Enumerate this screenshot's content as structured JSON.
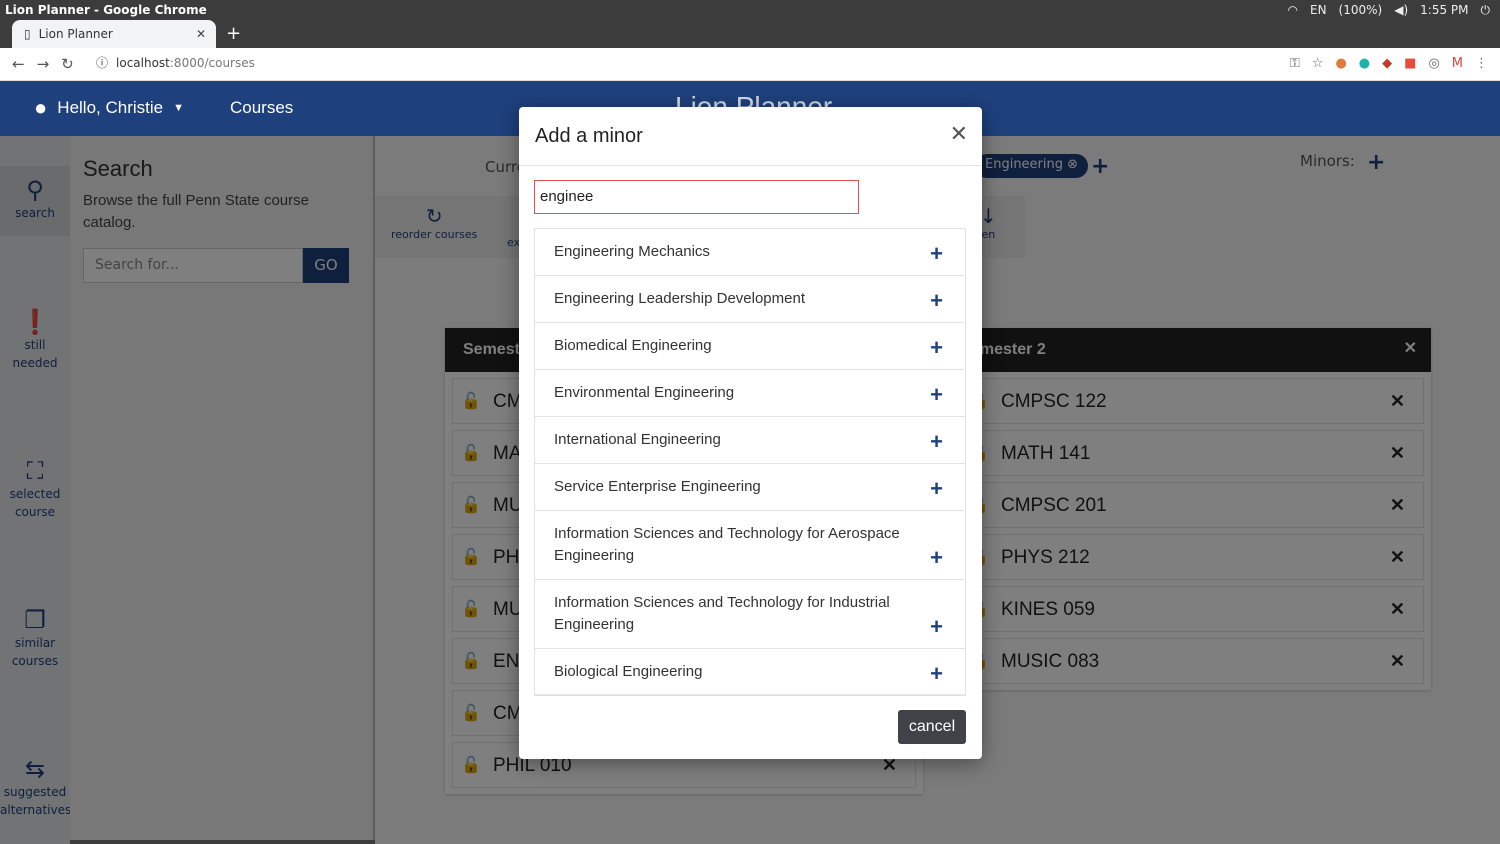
{
  "browser": {
    "window_title": "Lion Planner - Google Chrome",
    "tab_title": "Lion Planner",
    "url_host": "localhost",
    "url_rest": ":8000/courses",
    "os_lang": "EN",
    "battery": "(100%)",
    "time": "1:55 PM"
  },
  "header": {
    "greeting": "Hello, Christie",
    "courses_link": "Courses",
    "brand": "Lion Planner"
  },
  "sidenav": {
    "search": "search",
    "still_needed_1": "still",
    "still_needed_2": "needed",
    "selected_1": "selected",
    "selected_2": "course",
    "similar_1": "similar",
    "similar_2": "courses",
    "suggested_1": "suggested",
    "suggested_2": "alternatives"
  },
  "search_panel": {
    "title": "Search",
    "description": "Browse the full Penn State course catalog.",
    "placeholder": "Search for...",
    "go": "GO"
  },
  "main": {
    "current_label": "Curre",
    "major_chip": "Engineering",
    "minors_label": "Minors:",
    "toolbar_reorder": "reorder courses",
    "toolbar_ex": "ex",
    "toolbar_en": "en"
  },
  "semester1": {
    "title": "Semeste",
    "courses": [
      "CM",
      "MA",
      "MU",
      "PH",
      "MU",
      "EN",
      "CM",
      "PHIL 010"
    ]
  },
  "semester2": {
    "title": "emester 2",
    "courses": [
      "CMPSC 122",
      "MATH 141",
      "CMPSC 201",
      "PHYS 212",
      "KINES 059",
      "MUSIC 083"
    ]
  },
  "modal": {
    "title": "Add a minor",
    "input_value": "enginee",
    "results": [
      "Engineering Mechanics",
      "Engineering Leadership Development",
      "Biomedical Engineering",
      "Environmental Engineering",
      "International Engineering",
      "Service Enterprise Engineering",
      "Information Sciences and Technology for Aerospace Engineering",
      "Information Sciences and Technology for Industrial Engineering",
      "Biological Engineering"
    ],
    "cancel": "cancel"
  }
}
